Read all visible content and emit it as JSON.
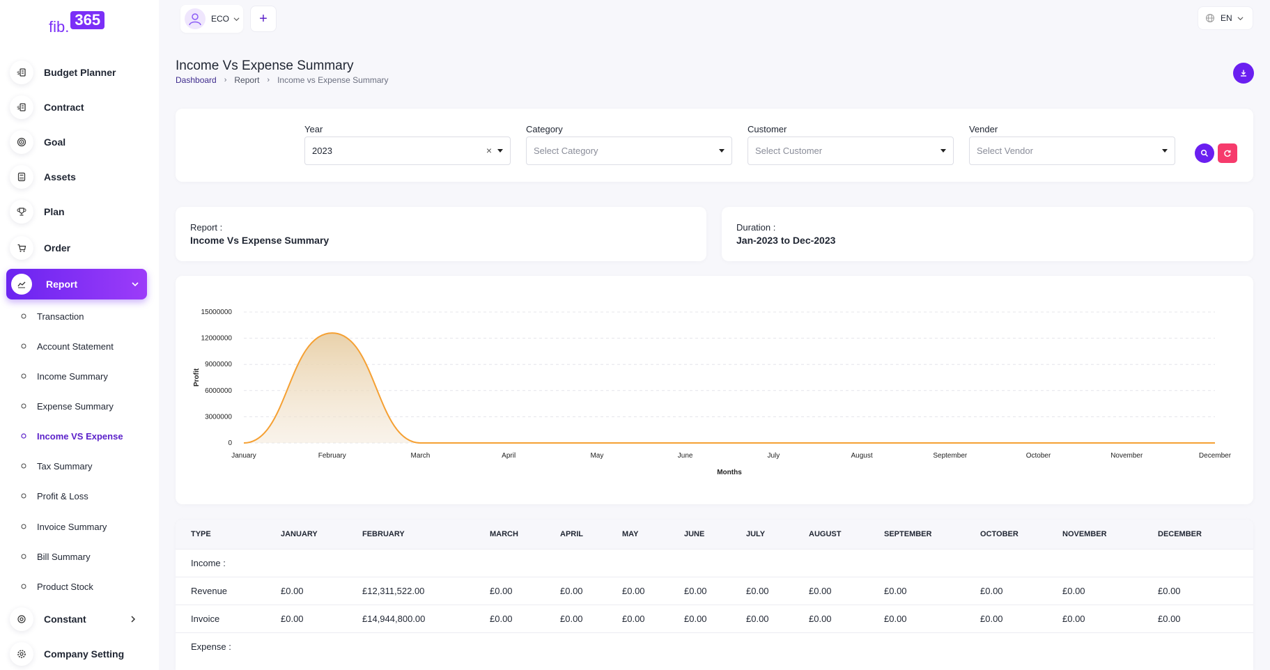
{
  "logo": {
    "prefix": "fib.",
    "number": "365"
  },
  "topbar": {
    "workspace": "ECO",
    "add_label": "+",
    "language": "EN"
  },
  "sidebar": {
    "items": [
      {
        "label": "Budget Planner"
      },
      {
        "label": "Contract"
      },
      {
        "label": "Goal"
      },
      {
        "label": "Assets"
      },
      {
        "label": "Plan"
      },
      {
        "label": "Order"
      }
    ],
    "active": {
      "label": "Report"
    },
    "subitems": [
      {
        "label": "Transaction"
      },
      {
        "label": "Account Statement"
      },
      {
        "label": "Income Summary"
      },
      {
        "label": "Expense Summary"
      },
      {
        "label": "Income VS Expense"
      },
      {
        "label": "Tax Summary"
      },
      {
        "label": "Profit & Loss"
      },
      {
        "label": "Invoice Summary"
      },
      {
        "label": "Bill Summary"
      },
      {
        "label": "Product Stock"
      }
    ],
    "bottom": [
      {
        "label": "Constant"
      },
      {
        "label": "Company Setting"
      }
    ]
  },
  "header": {
    "title": "Income Vs Expense Summary",
    "breadcrumb": [
      "Dashboard",
      "Report",
      "Income vs Expense Summary"
    ]
  },
  "filters": {
    "year": {
      "label": "Year",
      "value": "2023"
    },
    "category": {
      "label": "Category",
      "placeholder": "Select Category"
    },
    "customer": {
      "label": "Customer",
      "placeholder": "Select Customer"
    },
    "vendor": {
      "label": "Vender",
      "placeholder": "Select Vendor"
    }
  },
  "info": {
    "report_label": "Report :",
    "report_value": "Income Vs Expense Summary",
    "duration_label": "Duration :",
    "duration_value": "Jan-2023 to Dec-2023"
  },
  "chart_data": {
    "type": "area",
    "categories": [
      "January",
      "February",
      "March",
      "April",
      "May",
      "June",
      "July",
      "August",
      "September",
      "October",
      "November",
      "December"
    ],
    "series": [
      {
        "values": [
          0,
          12600000,
          0,
          0,
          0,
          0,
          0,
          0,
          0,
          0,
          0,
          0
        ]
      }
    ],
    "xlabel": "Months",
    "ylabel": "Profit",
    "ylim": [
      0,
      15000000
    ],
    "yticks": [
      "0",
      "3000000",
      "6000000",
      "9000000",
      "12000000",
      "15000000"
    ],
    "grid": true,
    "color": "#f5a033"
  },
  "table": {
    "columns": [
      "TYPE",
      "JANUARY",
      "FEBRUARY",
      "MARCH",
      "APRIL",
      "MAY",
      "JUNE",
      "JULY",
      "AUGUST",
      "SEPTEMBER",
      "OCTOBER",
      "NOVEMBER",
      "DECEMBER"
    ],
    "rows": [
      [
        "Income :"
      ],
      [
        "Revenue",
        "£0.00",
        "£12,311,522.00",
        "£0.00",
        "£0.00",
        "£0.00",
        "£0.00",
        "£0.00",
        "£0.00",
        "£0.00",
        "£0.00",
        "£0.00",
        "£0.00"
      ],
      [
        "Invoice",
        "£0.00",
        "£14,944,800.00",
        "£0.00",
        "£0.00",
        "£0.00",
        "£0.00",
        "£0.00",
        "£0.00",
        "£0.00",
        "£0.00",
        "£0.00",
        "£0.00"
      ],
      [
        "Expense :"
      ]
    ]
  },
  "colors": {
    "accent": "#6a1ff0",
    "danger": "#f63b6c",
    "chart": "#f5a033"
  }
}
